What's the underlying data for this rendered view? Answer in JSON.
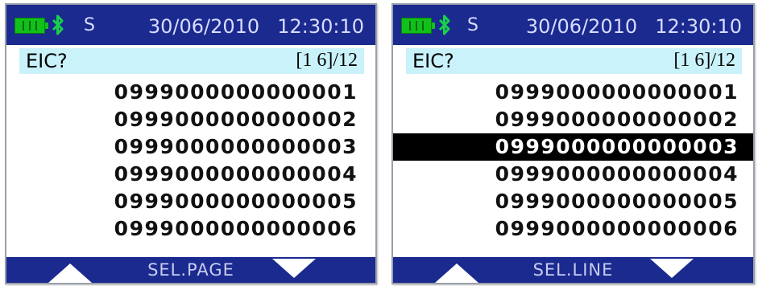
{
  "screens": [
    {
      "status": {
        "letter": "S",
        "date": "30/06/2010",
        "time": "12:30:10",
        "battery_icon": "battery-icon",
        "bluetooth_icon": "bluetooth-icon"
      },
      "prompt": {
        "label": "EIC?",
        "range": "[1  6]/12"
      },
      "items": [
        {
          "value": "0999000000000001"
        },
        {
          "value": "0999000000000002"
        },
        {
          "value": "0999000000000003"
        },
        {
          "value": "0999000000000004"
        },
        {
          "value": "0999000000000005"
        },
        {
          "value": "0999000000000006"
        }
      ],
      "selected_index": null,
      "bottom": {
        "label": "SEL.PAGE"
      }
    },
    {
      "status": {
        "letter": "S",
        "date": "30/06/2010",
        "time": "12:30:10",
        "battery_icon": "battery-icon",
        "bluetooth_icon": "bluetooth-icon"
      },
      "prompt": {
        "label": "EIC?",
        "range": "[1  6]/12"
      },
      "items": [
        {
          "value": "0999000000000001"
        },
        {
          "value": "0999000000000002"
        },
        {
          "value": "0999000000000003"
        },
        {
          "value": "0999000000000004"
        },
        {
          "value": "0999000000000005"
        },
        {
          "value": "0999000000000006"
        }
      ],
      "selected_index": 2,
      "bottom": {
        "label": "SEL.LINE"
      }
    }
  ],
  "colors": {
    "bar": "#1b2a8f",
    "prompt_bg": "#c9f2fb",
    "battery": "#12c01a",
    "bluetooth": "#18d24a",
    "selected_bg": "#000000"
  }
}
